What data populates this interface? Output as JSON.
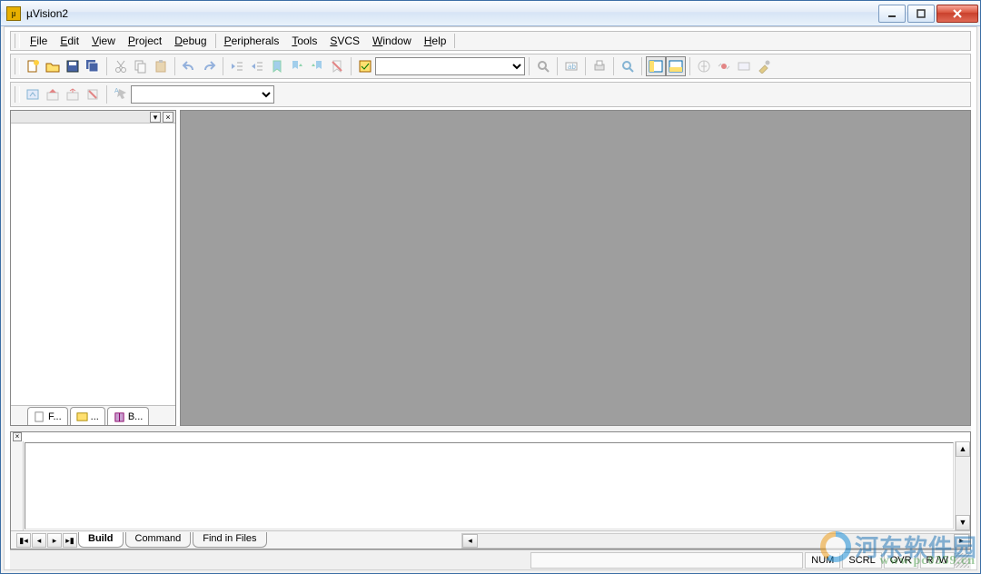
{
  "window": {
    "title": "µVision2"
  },
  "menu": {
    "items": [
      {
        "label": "File",
        "accel": "F"
      },
      {
        "label": "Edit",
        "accel": "E"
      },
      {
        "label": "View",
        "accel": "V"
      },
      {
        "label": "Project",
        "accel": "P"
      },
      {
        "label": "Debug",
        "accel": "D"
      },
      {
        "label": "Peripherals",
        "accel": "P"
      },
      {
        "label": "Tools",
        "accel": "T"
      },
      {
        "label": "SVCS",
        "accel": "S"
      },
      {
        "label": "Window",
        "accel": "W"
      },
      {
        "label": "Help",
        "accel": "H"
      }
    ]
  },
  "toolbar1": {
    "buttons": [
      {
        "name": "new-file-icon",
        "title": "New"
      },
      {
        "name": "open-file-icon",
        "title": "Open"
      },
      {
        "name": "save-icon",
        "title": "Save"
      },
      {
        "name": "save-all-icon",
        "title": "Save All"
      },
      {
        "sep": true
      },
      {
        "name": "cut-icon",
        "title": "Cut",
        "disabled": true
      },
      {
        "name": "copy-icon",
        "title": "Copy",
        "disabled": true
      },
      {
        "name": "paste-icon",
        "title": "Paste",
        "disabled": true
      },
      {
        "sep": true
      },
      {
        "name": "undo-icon",
        "title": "Undo",
        "disabled": true
      },
      {
        "name": "redo-icon",
        "title": "Redo",
        "disabled": true
      },
      {
        "sep": true
      },
      {
        "name": "indent-left-icon",
        "title": "Decrease Indent",
        "disabled": true
      },
      {
        "name": "indent-right-icon",
        "title": "Increase Indent",
        "disabled": true
      },
      {
        "name": "bookmark-toggle-icon",
        "title": "Toggle Bookmark",
        "disabled": true
      },
      {
        "name": "bookmark-next-icon",
        "title": "Next Bookmark",
        "disabled": true
      },
      {
        "name": "bookmark-prev-icon",
        "title": "Previous Bookmark",
        "disabled": true
      },
      {
        "name": "bookmark-clear-icon",
        "title": "Clear Bookmarks",
        "disabled": true
      },
      {
        "sep": true
      },
      {
        "name": "find-in-files-icon",
        "title": "Find in Files"
      },
      {
        "name": "find-combo",
        "combo": true,
        "value": ""
      },
      {
        "sep": true
      },
      {
        "name": "find-icon",
        "title": "Find",
        "disabled": true
      },
      {
        "sep": true
      },
      {
        "name": "incremental-find-icon",
        "title": "Incremental Find",
        "disabled": true
      },
      {
        "sep": true
      },
      {
        "name": "print-icon",
        "title": "Print",
        "disabled": true
      },
      {
        "sep": true
      },
      {
        "name": "debug-icon",
        "title": "Start/Stop Debug",
        "disabled": true
      },
      {
        "sep": true
      },
      {
        "name": "project-window-icon",
        "title": "Project Window",
        "active": true
      },
      {
        "name": "output-window-icon",
        "title": "Output Window",
        "active": true
      },
      {
        "sep": true
      },
      {
        "name": "browse-icon",
        "title": "Source Browser",
        "disabled": true
      },
      {
        "name": "options-icon",
        "title": "Options",
        "disabled": true
      },
      {
        "name": "configure-icon",
        "title": "Configure",
        "disabled": true
      },
      {
        "name": "tools-icon",
        "title": "Tools",
        "disabled": true
      }
    ]
  },
  "toolbar2": {
    "buttons": [
      {
        "name": "translate-icon",
        "title": "Translate",
        "disabled": true
      },
      {
        "name": "build-icon",
        "title": "Build",
        "disabled": true
      },
      {
        "name": "rebuild-icon",
        "title": "Rebuild",
        "disabled": true
      },
      {
        "name": "stop-build-icon",
        "title": "Stop Build",
        "disabled": true
      },
      {
        "sep": true
      },
      {
        "name": "download-icon",
        "title": "Download",
        "disabled": true
      },
      {
        "name": "target-combo",
        "combo": true,
        "value": ""
      }
    ]
  },
  "project_tabs": [
    {
      "label": "F...",
      "icon": "files-tab-icon"
    },
    {
      "label": "...",
      "icon": "regs-tab-icon"
    },
    {
      "label": "B...",
      "icon": "books-tab-icon"
    }
  ],
  "output_tabs": {
    "active": 0,
    "items": [
      "Build",
      "Command",
      "Find in Files"
    ]
  },
  "status": {
    "fields": [
      "",
      "NUM",
      "SCRL",
      "OVR",
      "R /W"
    ]
  },
  "watermark": {
    "text": "河东软件园",
    "url": "www.pc0359.cn"
  }
}
